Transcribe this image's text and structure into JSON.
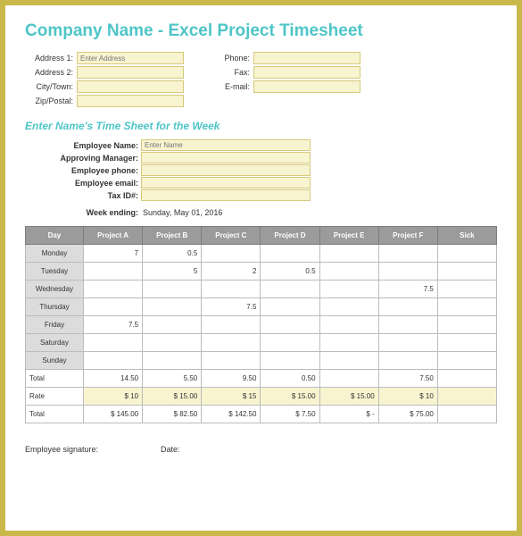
{
  "title": "Company Name - Excel Project Timesheet",
  "address": {
    "labels": {
      "addr1": "Address 1:",
      "addr2": "Address 2:",
      "city": "City/Town:",
      "zip": "Zip/Postal:",
      "phone": "Phone:",
      "fax": "Fax:",
      "email": "E-mail:"
    },
    "placeholders": {
      "addr1": "Enter Address"
    }
  },
  "subtitle": "Enter Name's Time Sheet for the Week",
  "employee": {
    "labels": {
      "name": "Employee Name:",
      "manager": "Approving Manager:",
      "phone": "Employee phone:",
      "email": "Employee email:",
      "taxid": "Tax ID#:"
    },
    "placeholders": {
      "name": "Enter Name"
    }
  },
  "week_ending": {
    "label": "Week ending:",
    "value": "Sunday, May 01, 2016"
  },
  "table": {
    "headers": [
      "Day",
      "Project A",
      "Project B",
      "Project C",
      "Project D",
      "Project E",
      "Project F",
      "Sick"
    ],
    "days": [
      "Monday",
      "Tuesday",
      "Wednesday",
      "Thursday",
      "Friday",
      "Saturday",
      "Sunday"
    ],
    "rows": [
      [
        "7",
        "0.5",
        "",
        "",
        "",
        "",
        ""
      ],
      [
        "",
        "5",
        "2",
        "0.5",
        "",
        "",
        ""
      ],
      [
        "",
        "",
        "",
        "",
        "",
        "7.5",
        ""
      ],
      [
        "",
        "",
        "7.5",
        "",
        "",
        "",
        ""
      ],
      [
        "7.5",
        "",
        "",
        "",
        "",
        "",
        ""
      ],
      [
        "",
        "",
        "",
        "",
        "",
        "",
        ""
      ],
      [
        "",
        "",
        "",
        "",
        "",
        "",
        ""
      ]
    ],
    "total_label": "Total",
    "totals": [
      "14.50",
      "5.50",
      "9.50",
      "0.50",
      "",
      "7.50",
      ""
    ],
    "rate_label": "Rate",
    "rates": [
      "$        10",
      "$        15.00",
      "$        15",
      "$        15.00",
      "$        15.00",
      "$        10",
      ""
    ],
    "grand_label": "Total",
    "grand": [
      "$      145.00",
      "$        82.50",
      "$      142.50",
      "$          7.50",
      "$              -",
      "$        75.00",
      ""
    ]
  },
  "signature": {
    "emp": "Employee signature:",
    "date": "Date:"
  }
}
